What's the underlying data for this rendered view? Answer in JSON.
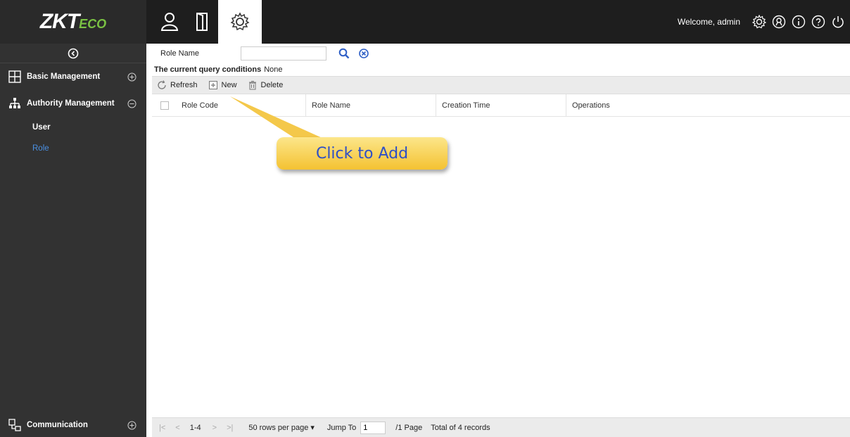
{
  "brand": {
    "logo_main": "ZKT",
    "logo_sub": "ECO"
  },
  "topnav": {
    "items": [
      {
        "name": "personnel",
        "icon": "person-icon"
      },
      {
        "name": "access",
        "icon": "door-icon"
      },
      {
        "name": "system",
        "icon": "gear-icon",
        "active": true
      }
    ]
  },
  "header": {
    "welcome": "Welcome, admin",
    "icons": [
      "settings-icon",
      "user-circle-icon",
      "info-icon",
      "help-icon",
      "power-icon"
    ]
  },
  "sidebar": {
    "sections": [
      {
        "label": "Basic Management",
        "icon": "grid-icon",
        "state": "collapsed"
      },
      {
        "label": "Authority Management",
        "icon": "hierarchy-icon",
        "state": "expanded"
      }
    ],
    "items": [
      {
        "label": "User",
        "active": false
      },
      {
        "label": "Role",
        "active": true
      }
    ],
    "bottom": {
      "label": "Communication",
      "icon": "network-icon",
      "state": "collapsed"
    }
  },
  "search": {
    "label": "Role Name",
    "value": ""
  },
  "query": {
    "label": "The current query conditions",
    "value": "None"
  },
  "toolbar": {
    "refresh": "Refresh",
    "new": "New",
    "delete": "Delete"
  },
  "table": {
    "columns": [
      "Role Code",
      "Role Name",
      "Creation Time",
      "Operations"
    ],
    "rows": []
  },
  "pager": {
    "range": "1-4",
    "rows_per_page": "50 rows per page",
    "jump_label": "Jump To",
    "jump_value": "1",
    "pages": "/1 Page",
    "total": "Total of 4 records"
  },
  "callout": {
    "text": "Click to Add"
  },
  "colors": {
    "topbar": "#1e1e1e",
    "sidebar": "#323232",
    "active_link": "#4a90e2",
    "search_icon": "#2e5fc6",
    "callout": "#f4c232"
  }
}
